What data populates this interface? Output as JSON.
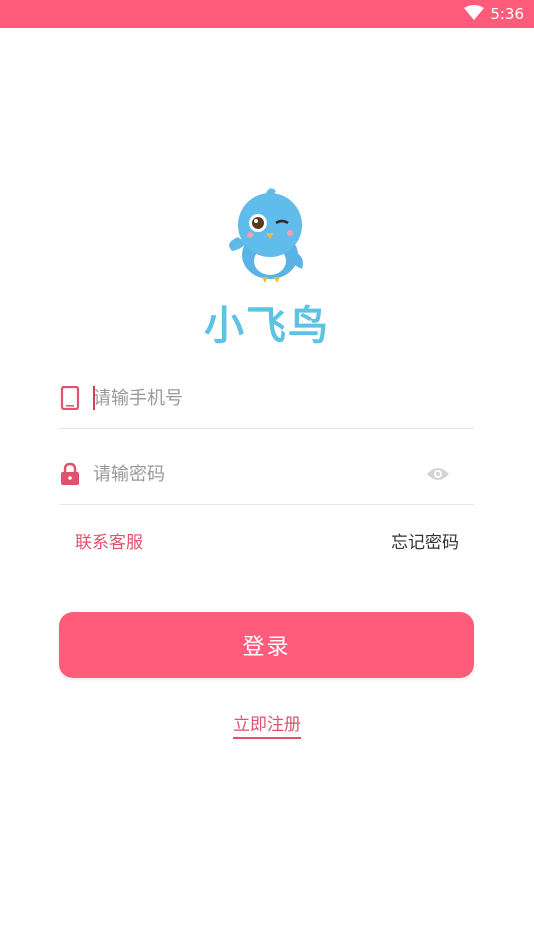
{
  "status_bar": {
    "time": "5:36",
    "wifi_icon": "wifi-icon"
  },
  "logo": {
    "brand_text": "小飞鸟",
    "mascot_icon": "bird-mascot-icon"
  },
  "phone_field": {
    "placeholder": "请输手机号",
    "icon": "phone-icon"
  },
  "password_field": {
    "placeholder": "请输密码",
    "icon": "lock-icon",
    "toggle_icon": "eye-icon"
  },
  "links": {
    "contact_support": "联系客服",
    "forgot_password": "忘记密码"
  },
  "login_button": {
    "label": "登录"
  },
  "register_link": {
    "label": "立即注册"
  },
  "colors": {
    "accent": "#ff5c7b",
    "accent_text": "#e0526e",
    "brand_blue": "#5ec2e3"
  }
}
